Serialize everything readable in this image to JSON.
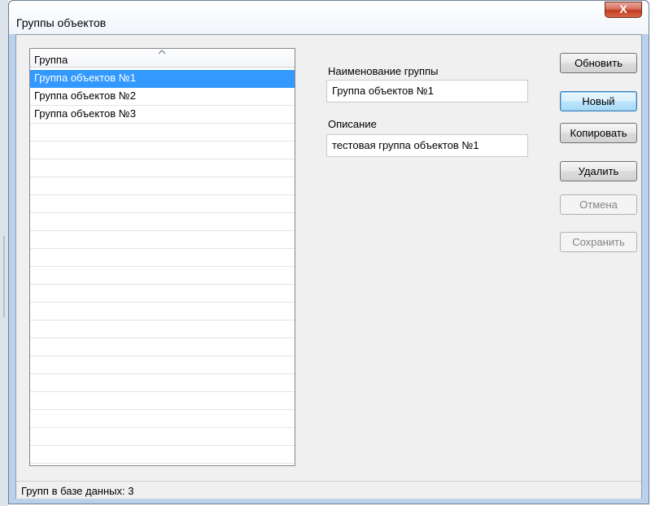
{
  "window": {
    "title": "Группы объектов",
    "close_label": "X"
  },
  "list": {
    "column_header": "Группа",
    "items": [
      {
        "label": "Группа объектов №1",
        "selected": true
      },
      {
        "label": "Группа объектов №2",
        "selected": false
      },
      {
        "label": "Группа объектов №3",
        "selected": false
      }
    ]
  },
  "form": {
    "name_label": "Наименование группы",
    "name_value": "Группа объектов №1",
    "description_label": "Описание",
    "description_value": "тестовая группа объектов №1"
  },
  "buttons": {
    "refresh": "Обновить",
    "new": "Новый",
    "copy": "Копировать",
    "delete": "Удалить",
    "cancel": "Отмена",
    "save": "Сохранить"
  },
  "status": {
    "text": "Групп в базе данных: 3"
  },
  "colors": {
    "selection": "#3399ff",
    "window_frame": "#b9d1ea",
    "dialog_bg": "#f0f0f0"
  }
}
